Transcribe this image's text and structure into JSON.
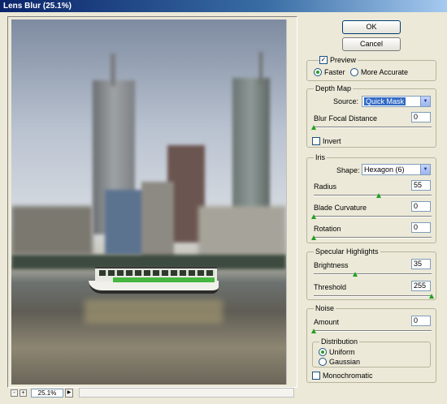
{
  "window": {
    "title": "Lens Blur (25.1%)"
  },
  "buttons": {
    "ok": "OK",
    "cancel": "Cancel"
  },
  "preview": {
    "label": "Preview",
    "checked": true,
    "faster": "Faster",
    "more_accurate": "More Accurate",
    "mode": "Faster"
  },
  "depth_map": {
    "title": "Depth Map",
    "source_label": "Source:",
    "source_value": "Quick Mask",
    "focal_label": "Blur Focal Distance",
    "focal_value": "0",
    "invert_label": "Invert"
  },
  "iris": {
    "title": "Iris",
    "shape_label": "Shape:",
    "shape_value": "Hexagon (6)",
    "radius_label": "Radius",
    "radius_value": "55",
    "curvature_label": "Blade Curvature",
    "curvature_value": "0",
    "rotation_label": "Rotation",
    "rotation_value": "0"
  },
  "specular": {
    "title": "Specular Highlights",
    "brightness_label": "Brightness",
    "brightness_value": "35",
    "threshold_label": "Threshold",
    "threshold_value": "255"
  },
  "noise": {
    "title": "Noise",
    "amount_label": "Amount",
    "amount_value": "0",
    "distribution_title": "Distribution",
    "uniform": "Uniform",
    "gaussian": "Gaussian",
    "distribution": "Uniform",
    "mono_label": "Monochromatic"
  },
  "zoom": {
    "value": "25.1%",
    "minus": "-",
    "plus": "+"
  }
}
